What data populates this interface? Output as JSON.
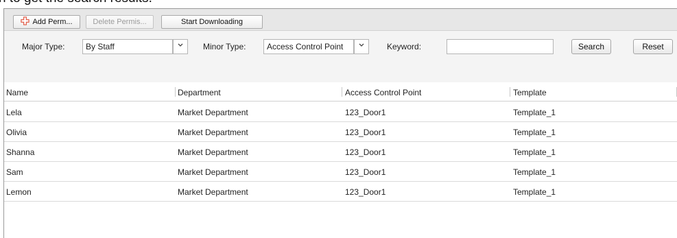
{
  "caption_partial": "n to get the search results.",
  "toolbar": {
    "add_label": "Add Perm...",
    "delete_label": "Delete Permis...",
    "download_label": "Start Downloading"
  },
  "filters": {
    "major_label": "Major Type:",
    "major_value": "By Staff",
    "minor_label": "Minor Type:",
    "minor_value": "Access Control Point",
    "keyword_label": "Keyword:",
    "keyword_value": "",
    "search_label": "Search",
    "reset_label": "Reset"
  },
  "table": {
    "columns": [
      "Name",
      "Department",
      "Access Control Point",
      "Template"
    ],
    "rows": [
      [
        "Lela",
        "Market Department",
        "123_Door1",
        "Template_1"
      ],
      [
        "Olivia",
        "Market Department",
        "123_Door1",
        "Template_1"
      ],
      [
        "Shanna",
        "Market Department",
        "123_Door1",
        "Template_1"
      ],
      [
        "Sam",
        "Market Department",
        "123_Door1",
        "Template_1"
      ],
      [
        "Lemon",
        "Market Department",
        "123_Door1",
        "Template_1"
      ]
    ]
  },
  "icons": {
    "add": "plus-icon",
    "dropdown": "chevron-down-icon"
  },
  "colors": {
    "toolbar_bg": "#e7e7e7",
    "filter_bg": "#f4f4f4",
    "add_icon": "#e0503a"
  }
}
